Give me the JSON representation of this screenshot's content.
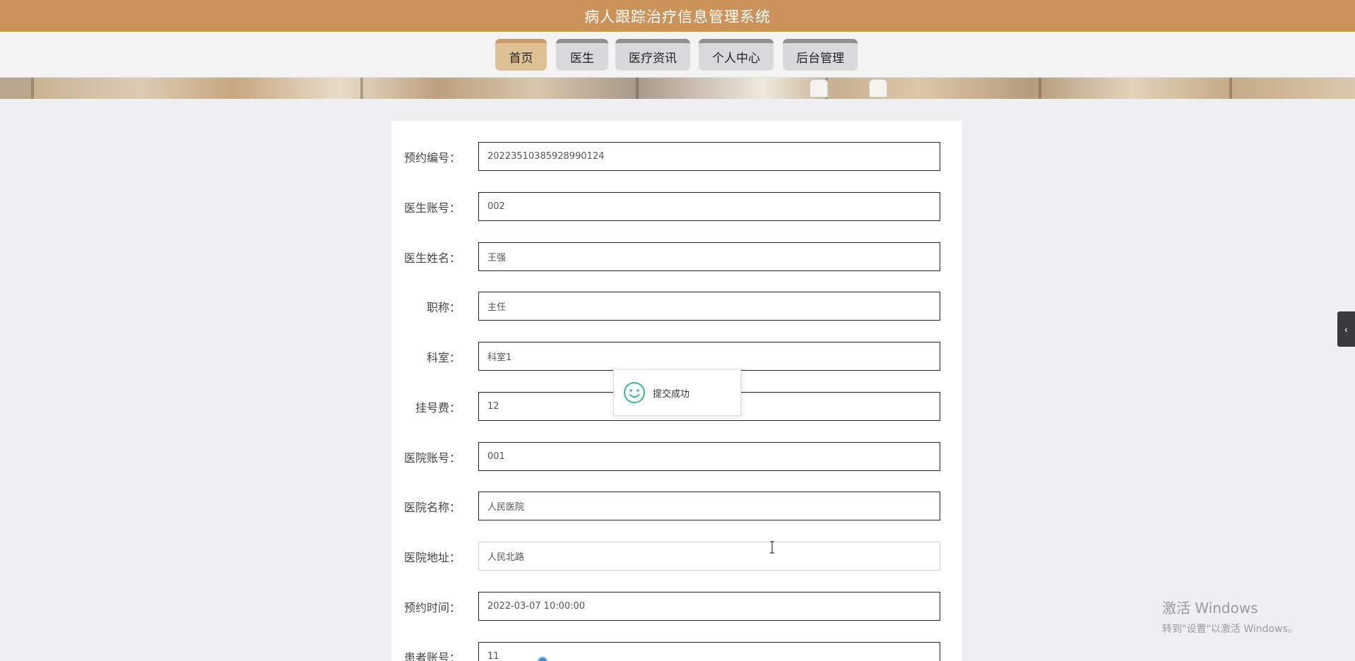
{
  "app": {
    "title": "病人跟踪治疗信息管理系统"
  },
  "nav": {
    "items": [
      {
        "label": "首页",
        "active": true
      },
      {
        "label": "医生",
        "active": false
      },
      {
        "label": "医疗资讯",
        "active": false
      },
      {
        "label": "个人中心",
        "active": false
      },
      {
        "label": "后台管理",
        "active": false
      }
    ]
  },
  "form": {
    "fields": [
      {
        "label": "预约编号：",
        "value": "20223510385928990124"
      },
      {
        "label": "医生账号：",
        "value": "002"
      },
      {
        "label": "医生姓名：",
        "value": "王强"
      },
      {
        "label": "职称：",
        "value": "主任"
      },
      {
        "label": "科室：",
        "value": "科室1"
      },
      {
        "label": "挂号费：",
        "value": "12"
      },
      {
        "label": "医院账号：",
        "value": "001"
      },
      {
        "label": "医院名称：",
        "value": "人民医院"
      },
      {
        "label": "医院地址：",
        "value": "人民北路"
      },
      {
        "label": "预约时间：",
        "value": "2022-03-07 10:00:00"
      },
      {
        "label": "患者账号：",
        "value": "11"
      }
    ]
  },
  "toast": {
    "message": "提交成功",
    "icon": "smile-icon",
    "color": "#3cb98a"
  },
  "side_tab": {
    "icon": "chevron-left-icon",
    "glyph": "‹"
  },
  "watermark": {
    "line1": "激活 Windows",
    "line2": "转到\"设置\"以激活 Windows。"
  },
  "colors": {
    "header": "#cb9259",
    "nav_active": "#dfc196",
    "nav_inactive": "#d9d9dc",
    "background": "#efeff1"
  }
}
